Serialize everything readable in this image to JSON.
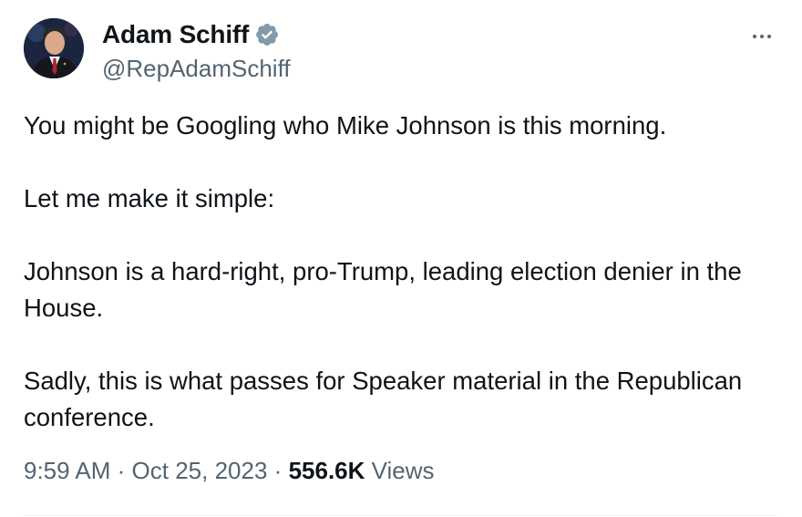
{
  "author": {
    "display_name": "Adam Schiff",
    "handle": "@RepAdamSchiff",
    "verified": true,
    "verified_color": "#829aab",
    "avatar_icon": "avatar-photo"
  },
  "more_icon": "more-horizontal-icon",
  "tweet": {
    "paragraphs": [
      "You might be Googling who Mike Johnson is this morning.",
      "Let me make it simple:",
      "Johnson is a hard-right, pro-Trump, leading election denier in the House.",
      "Sadly, this is what passes for Speaker material in the Republican conference."
    ]
  },
  "meta": {
    "time": "9:59 AM",
    "separator": "·",
    "date": "Oct 25, 2023",
    "views_count": "556.6K",
    "views_label": "Views"
  },
  "colors": {
    "text_primary": "#0f1419",
    "text_secondary": "#536471",
    "divider": "#eff3f4"
  }
}
